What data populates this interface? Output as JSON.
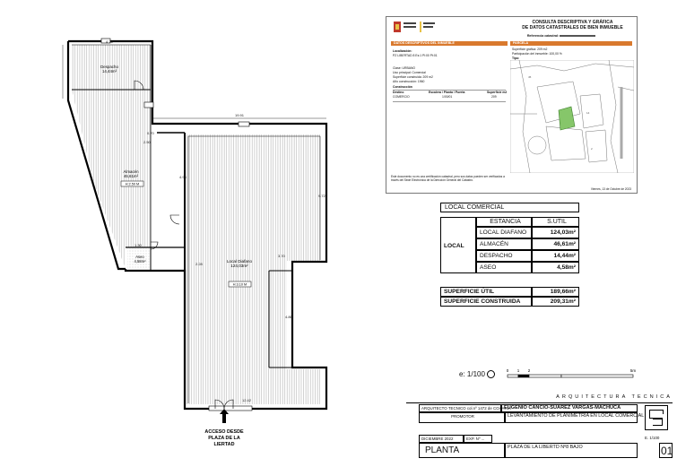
{
  "plan": {
    "rooms": [
      {
        "name": "Despacho",
        "area": "14,44m²"
      },
      {
        "name": "Almacén",
        "area": "46,61m²"
      },
      {
        "name": "Aseo",
        "area": "4,58m²"
      },
      {
        "name": "Local Diafano",
        "area": "124,03m²"
      }
    ],
    "dims": {
      "top_wide": "19.91",
      "almacen_box": "H:2.50 M",
      "local_box": "H:3.10 M"
    },
    "access_label": [
      "ACCESO DESDE",
      "PLAZA DE LA",
      "LIERTAD"
    ]
  },
  "cadastral": {
    "title": [
      "CONSULTA DESCRIPTIVA Y GRÁFICA",
      "DE DATOS CATASTRALES DE BIEN INMUEBLE"
    ],
    "reference_label": "Referencia catastral:",
    "bar_left": "DATOS DESCRIPTIVOS DEL INMUEBLE",
    "bar_right": "PARCELA",
    "lines": [
      "Localización:",
      "PZ LIBERTAD 8 Es:1 Pl:00 Pt:01",
      "Clase: URBANO",
      "Uso principal: Comercial",
      "Superficie construida: 209 m2",
      "Año construcción: 1960"
    ],
    "parcel_lines": [
      "Superficie gráfica: 209 m2",
      "Participación del inmueble: 100,00 %",
      "Tipo:"
    ],
    "construction": "Construcción",
    "table_head": [
      "Destino",
      "Escalera / Planta / Puerta",
      "Superficie m2"
    ],
    "table_row": [
      "COMERCIO",
      "1/00/01",
      "209"
    ],
    "footer": "Este documento no es una certificación catastral, pero sus datos pueden ser verificados a través del Sede Electrónica de la Dirección General del Catastro.",
    "date": "Viernes, 13 de Octubre de 2023"
  },
  "surfaces": {
    "title": "LOCAL COMERCIAL",
    "col_estancia": "ESTANCIA",
    "col_sutil": "S.ÚTIL",
    "group": "LOCAL",
    "rows": [
      {
        "name": "LOCAL DIAFANO",
        "value": "124,03m²"
      },
      {
        "name": "ALMACÉN",
        "value": "46,61m²"
      },
      {
        "name": "DESPACHO",
        "value": "14,44m²"
      },
      {
        "name": "ASEO",
        "value": "4,58m²"
      }
    ],
    "total_util_label": "SUPERFICIE ÚTIL",
    "total_util": "189,66m²",
    "total_const_label": "SUPERFICIE CONSTRUIDA",
    "total_const": "209,31m²"
  },
  "scale": {
    "label": "e: 1/100",
    "ticks": [
      "0",
      "1",
      "2",
      "5m"
    ]
  },
  "title_block": {
    "header": "ARQUITECTURA TECNICA",
    "architect_prefix": "ARQUITECTO TECNICO col.nº 1472 de COAATJA",
    "architect_name": "EUGENIO CANCIO-SUAREZ VARGAS-MACHUCA",
    "promotor_label": "PROMOTOR",
    "project": "LEVANTAMIENTO DE PLANIMETRIA EN LOCAL COMERCIAL",
    "date": "DICIEMBRE 2022",
    "exp": "EXP. Nº ...",
    "scale": "E. 1/100",
    "plane_title": "PLANTA",
    "address": "PLAZA DE LA LIBERTD Nº8 BAJO",
    "sheet": "01"
  },
  "colors": {
    "orange": "#d9792d",
    "green": "#86c66a",
    "red": "#c0392b"
  }
}
